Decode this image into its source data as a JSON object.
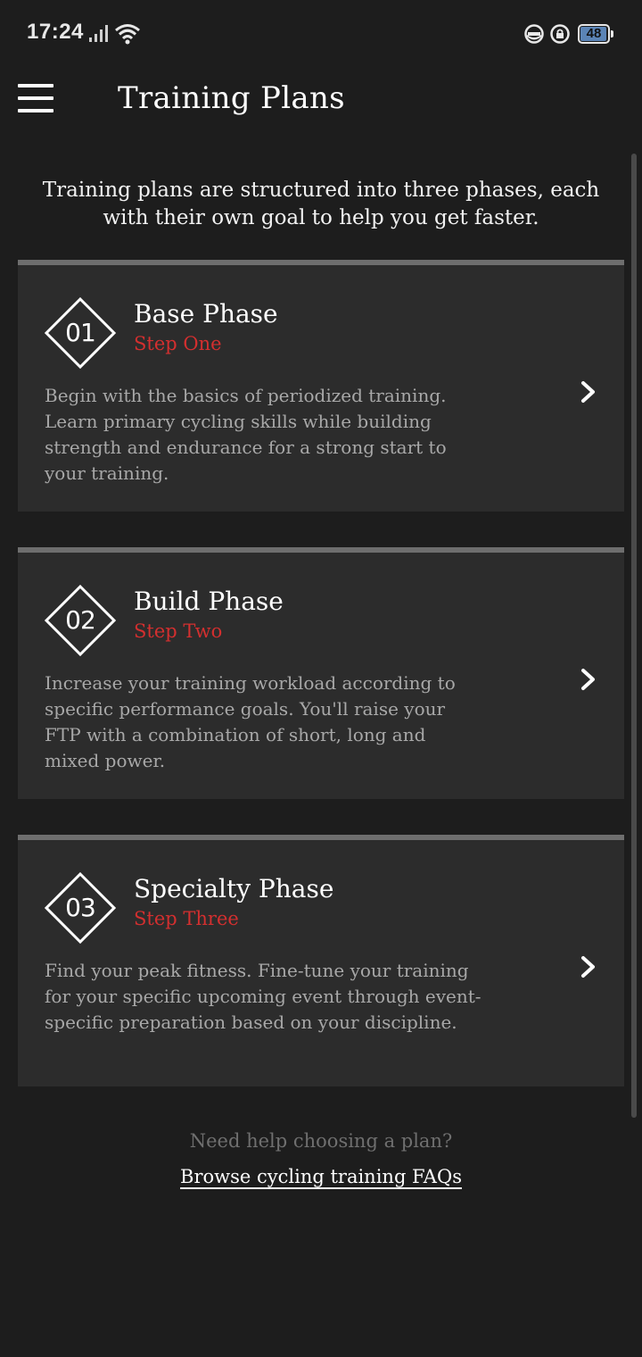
{
  "status_bar": {
    "time": "17:24",
    "battery_level": "48",
    "icons": [
      "signal-icon",
      "wifi-icon",
      "dnd-icon",
      "rotation-lock-icon",
      "battery-icon"
    ]
  },
  "header": {
    "title": "Training Plans",
    "menu_icon": "hamburger-menu-icon"
  },
  "intro": "Training plans are structured into three phases, each with their own goal to help you get faster.",
  "phases": [
    {
      "number": "01",
      "title": "Base Phase",
      "step": "Step One",
      "description": "Begin with the basics of periodized training. Learn primary cycling skills while building strength and endurance for a strong start to your training."
    },
    {
      "number": "02",
      "title": "Build Phase",
      "step": "Step Two",
      "description": "Increase your training workload according to specific performance goals. You'll raise your FTP with a combination of short, long and mixed power."
    },
    {
      "number": "03",
      "title": "Specialty Phase",
      "step": "Step Three",
      "description": "Find your peak fitness. Fine-tune your training for your specific upcoming event through event-specific preparation based on your discipline."
    }
  ],
  "footer": {
    "help_text": "Need help choosing a plan?",
    "faq_link": "Browse cycling training FAQs"
  },
  "colors": {
    "background": "#1d1d1d",
    "card": "#2c2c2c",
    "card_top_border": "#6e6e6e",
    "accent_red": "#d32f2f",
    "muted_text": "#a8a8a8"
  }
}
